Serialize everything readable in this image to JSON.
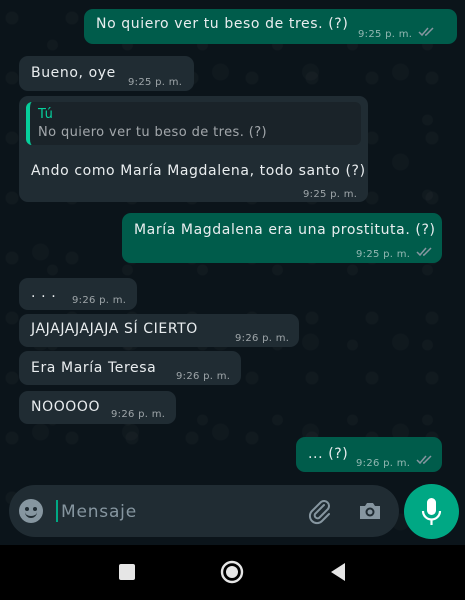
{
  "messages": [
    {
      "text": "No quiero ver tu beso de tres. (?)",
      "time": "9:25 p. m."
    },
    {
      "text": "Bueno, oye",
      "time": "9:25 p. m."
    },
    {
      "quote_author": "Tú",
      "quote_text": "No quiero ver tu beso de tres. (?)",
      "text": "Ando como María Magdalena, todo santo (?)",
      "time": "9:25 p. m."
    },
    {
      "text": "María Magdalena era una prostituta. (?)",
      "time": "9:25 p. m."
    },
    {
      "text": ". . .",
      "time": "9:26 p. m."
    },
    {
      "text": "JAJAJAJAJAJA SÍ CIERTO",
      "time": "9:26 p. m."
    },
    {
      "text": "Era María Teresa",
      "time": "9:26 p. m."
    },
    {
      "text": "NOOOOO",
      "time": "9:26 p. m."
    },
    {
      "text": "... (?)",
      "time": "9:26 p. m."
    }
  ],
  "composer": {
    "placeholder": "Mensaje"
  },
  "icons": {
    "emoji": "emoji-icon",
    "attach": "paperclip-icon",
    "camera": "camera-icon",
    "mic": "mic-icon",
    "nav_recents": "square-icon",
    "nav_home": "circle-icon",
    "nav_back": "triangle-back-icon",
    "read_receipt": "double-check-icon"
  },
  "colors": {
    "background": "#0b141a",
    "outgoing_bubble": "#005c4b",
    "incoming_bubble": "#202c33",
    "accent": "#00a884",
    "quote_accent": "#06cf9c"
  }
}
